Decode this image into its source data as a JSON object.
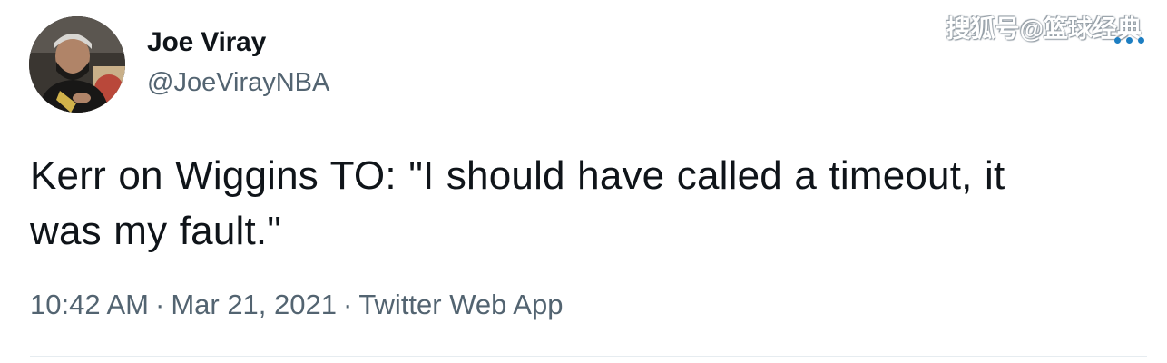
{
  "author": {
    "display_name": "Joe Viray",
    "handle": "@JoeVirayNBA"
  },
  "tweet": {
    "text_line1": "Kerr on Wiggins TO: \"I should have called a timeout, it",
    "text_line2": "was my fault.\""
  },
  "meta": {
    "time": "10:42 AM",
    "separator": "·",
    "date": "Mar 21, 2021",
    "source": "Twitter Web App"
  },
  "watermark": "搜狐号@篮球经典",
  "icons": {
    "more": "more-options-icon"
  },
  "colors": {
    "text": "#0f1419",
    "secondary": "#536471",
    "accent": "#1d7ec2",
    "divider": "#e6ecf0"
  }
}
